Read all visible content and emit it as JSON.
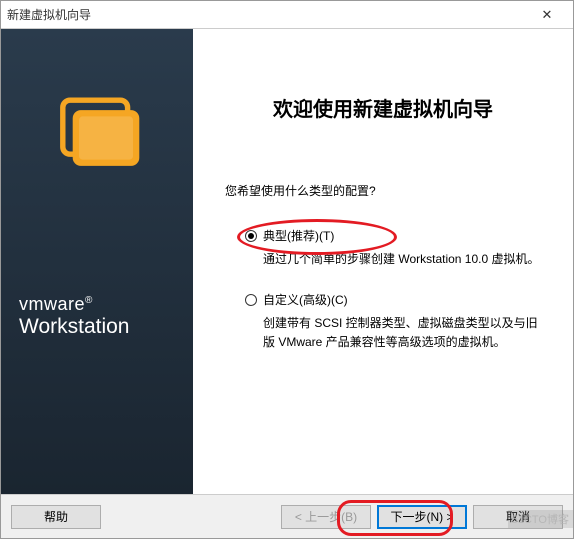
{
  "title": "新建虚拟机向导",
  "close": "✕",
  "banner": {
    "brand": "vmware",
    "product": "Workstation"
  },
  "main": {
    "heading": "欢迎使用新建虚拟机向导",
    "question": "您希望使用什么类型的配置?",
    "options": {
      "typical": {
        "label": "典型(推荐)(T)",
        "desc": "通过几个简单的步骤创建 Workstation 10.0 虚拟机。",
        "selected": true
      },
      "custom": {
        "label": "自定义(高级)(C)",
        "desc": "创建带有 SCSI 控制器类型、虚拟磁盘类型以及与旧版 VMware 产品兼容性等高级选项的虚拟机。",
        "selected": false
      }
    }
  },
  "buttons": {
    "help": "帮助",
    "back": "< 上一步(B)",
    "next": "下一步(N) >",
    "cancel": "取消"
  },
  "watermark": "51CTO博客"
}
